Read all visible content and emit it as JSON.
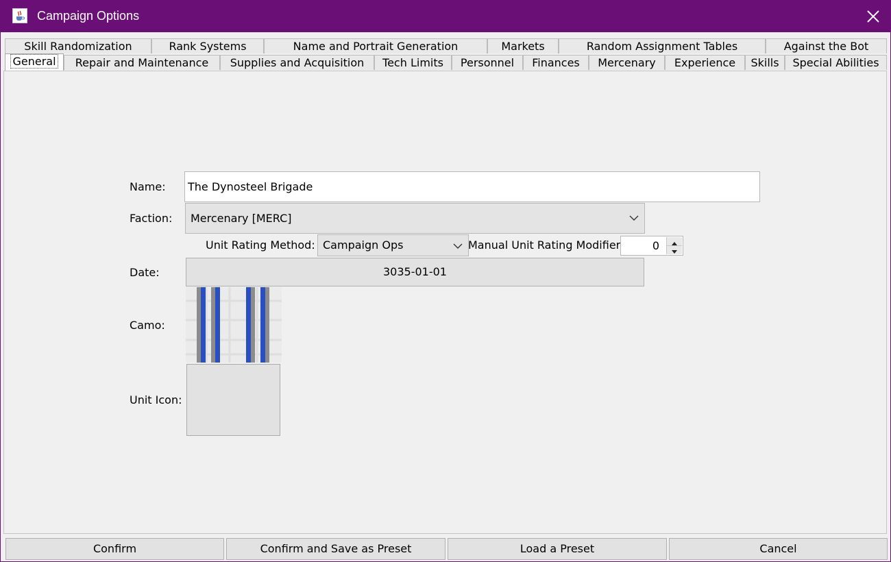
{
  "window": {
    "title": "Campaign Options"
  },
  "tabs_row1": [
    {
      "label": "Skill Randomization"
    },
    {
      "label": "Rank Systems"
    },
    {
      "label": "Name and Portrait Generation"
    },
    {
      "label": "Markets"
    },
    {
      "label": "Random Assignment Tables"
    },
    {
      "label": "Against the Bot"
    }
  ],
  "tabs_row2": [
    {
      "label": "General",
      "selected": true
    },
    {
      "label": "Repair and Maintenance"
    },
    {
      "label": "Supplies and Acquisition"
    },
    {
      "label": "Tech Limits"
    },
    {
      "label": "Personnel"
    },
    {
      "label": "Finances"
    },
    {
      "label": "Mercenary"
    },
    {
      "label": "Experience"
    },
    {
      "label": "Skills"
    },
    {
      "label": "Special Abilities"
    }
  ],
  "general": {
    "name_label": "Name:",
    "name_value": "The Dynosteel Brigade",
    "faction_label": "Faction:",
    "faction_value": "Mercenary [MERC]",
    "unit_rating_label": "Unit Rating Method:",
    "unit_rating_value": "Campaign Ops",
    "manual_modifier_label": "Manual Unit Rating Modifier",
    "manual_modifier_value": "0",
    "date_label": "Date:",
    "date_value": "3035-01-01",
    "camo_label": "Camo:",
    "unit_icon_label": "Unit Icon:"
  },
  "buttons": {
    "confirm": "Confirm",
    "confirm_save_preset": "Confirm and Save as Preset",
    "load_preset": "Load a Preset",
    "cancel": "Cancel"
  },
  "colors": {
    "titlebar": "#6a0f75",
    "camo_stripe_blue": "#2a4fc0",
    "camo_stripe_gray": "#8c8c8c"
  },
  "icons": {
    "title": "java-coffee-icon",
    "close": "close-icon",
    "dropdown": "chevron-down-icon"
  }
}
